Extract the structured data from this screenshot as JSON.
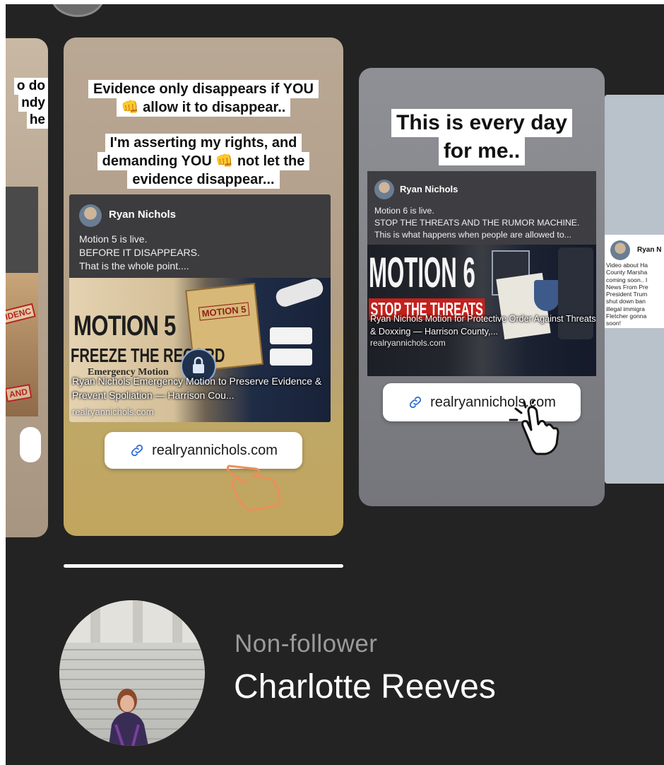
{
  "left_card": {
    "caption_fragments": [
      "o do",
      "ndy",
      "he"
    ],
    "stamp_1": "IDENC",
    "stamp_2": "AND"
  },
  "main_card": {
    "caption_lines_1": [
      "Evidence only disappears if YOU",
      "👊 allow it to disappear.."
    ],
    "caption_lines_2": [
      "I'm asserting my rights, and",
      "demanding YOU 👊 not let the",
      "evidence disappear..."
    ],
    "post": {
      "author": "Ryan Nichols",
      "text": "Motion 5 is live.\nBEFORE IT DISAPPEARS.\nThat is the whole point....",
      "media_title": "MOTION 5",
      "media_subtitle": "FREEZE THE RECORD",
      "media_tag": "Emergency Motion",
      "folder_label": "MOTION 5",
      "link_title": "Ryan Nichols Emergency Motion to Preserve Evidence & Prevent Spoliation — Harrison Cou...",
      "link_domain": "realryannichols.com"
    },
    "link_sticker": "realryannichols.com"
  },
  "center_card": {
    "caption_lines": [
      "This is every day",
      "for me.."
    ],
    "post": {
      "author": "Ryan Nichols",
      "text": "Motion 6 is live.\nSTOP THE THREATS AND THE RUMOR MACHINE.\nThis is what happens when people are allowed to...",
      "media_title": "MOTION 6",
      "media_subtitle": "STOP THE THREATS",
      "link_title": "Ryan Nichols Motion for Protective Order Against Threats & Doxxing — Harrison County,...",
      "link_domain": "realryannichols.com"
    },
    "link_sticker": "realryannichols.com"
  },
  "right_card": {
    "post_author": "Ryan N",
    "post_text": "Video about Ha\nCounty Marsha\ncoming soon.. I\nNews From Pre\nPresident Trum\nshut down ban\nillegal immigra\nFletcher gonna\nsoon!"
  },
  "viewer": {
    "status": "Non-follower",
    "name": "Charlotte Reeves"
  },
  "colors": {
    "screen_bg": "#232323",
    "sticker_bg": "#ffffff",
    "link_icon": "#2f6fd6",
    "stop_red": "#c4211c"
  }
}
